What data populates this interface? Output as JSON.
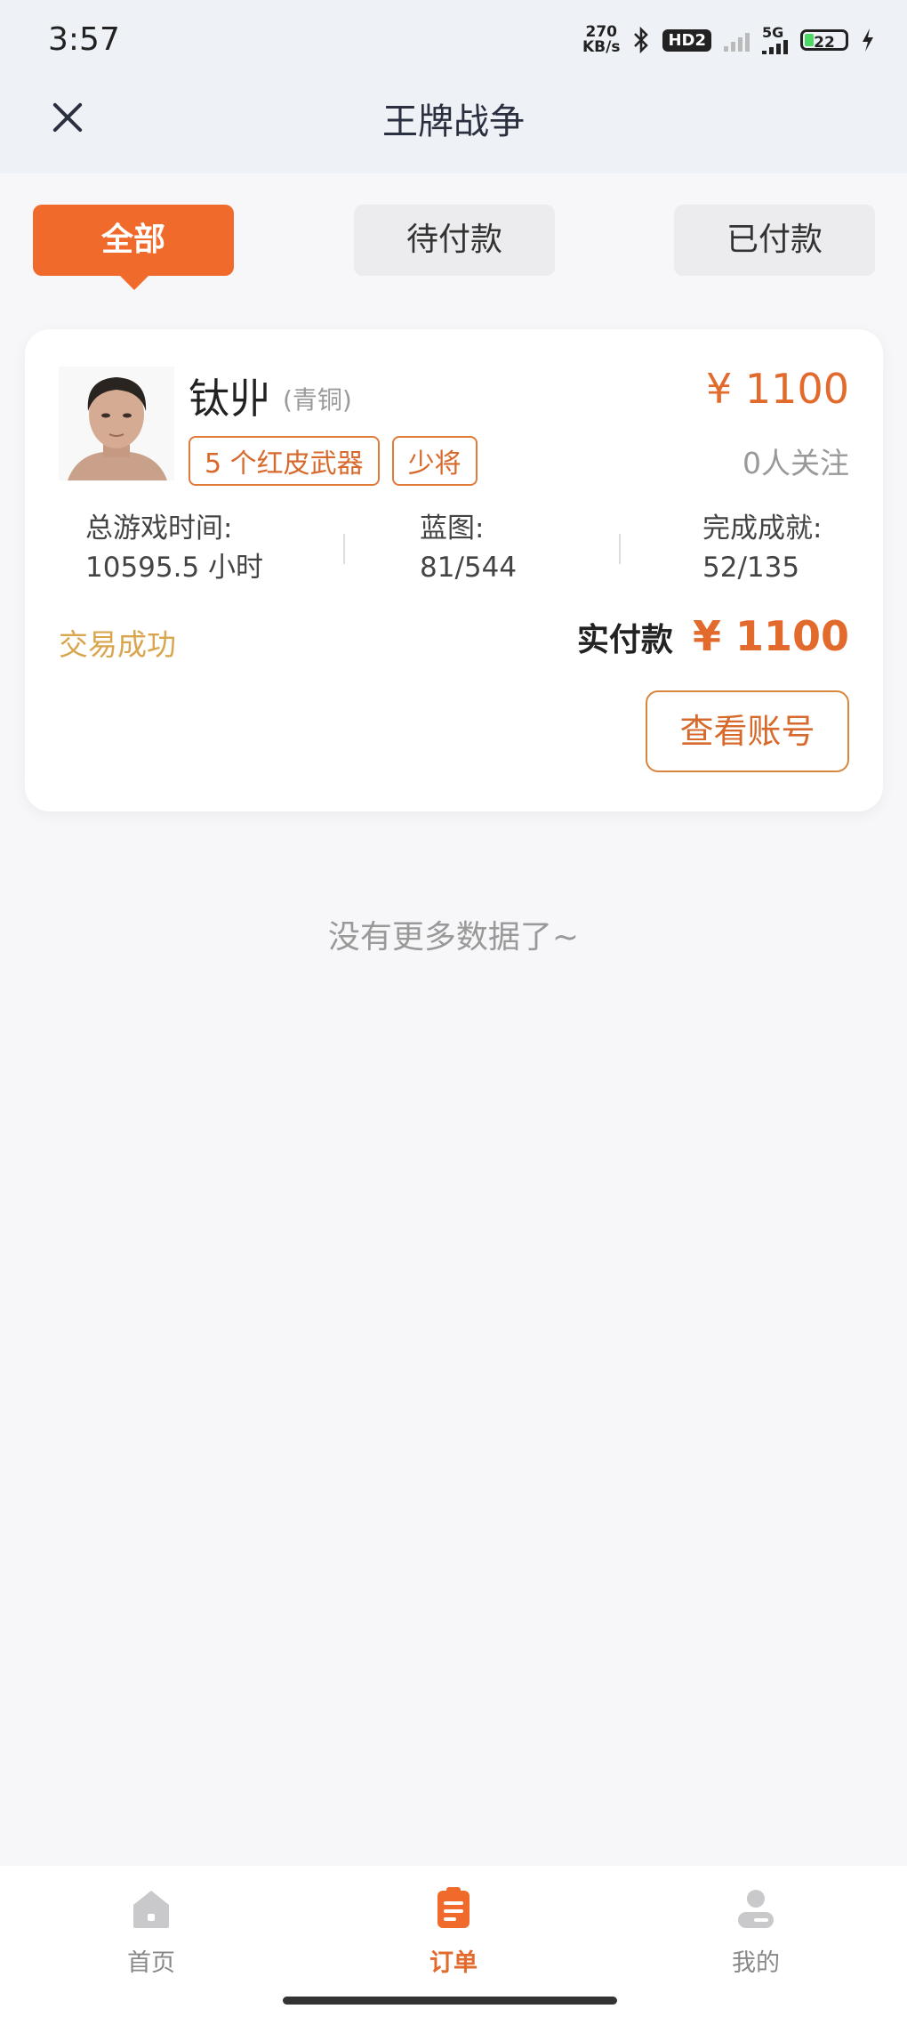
{
  "status_bar": {
    "time": "3:57",
    "net_speed_value": "270",
    "net_speed_unit": "KB/s",
    "hd_badge": "HD2",
    "network": "5G",
    "battery": "22"
  },
  "header": {
    "title": "王牌战争",
    "close_icon": "close-icon"
  },
  "tabs": [
    {
      "label": "全部",
      "active": true
    },
    {
      "label": "待付款",
      "active": false
    },
    {
      "label": "已付款",
      "active": false
    }
  ],
  "order": {
    "nickname": "钛丱",
    "rank": "(青铜)",
    "price": "¥ 1100",
    "tags": [
      "5 个红皮武器",
      "少将"
    ],
    "followers": "0人关注",
    "stats": [
      {
        "label": "总游戏时间:",
        "value": "10595.5 小时"
      },
      {
        "label": "蓝图:",
        "value": "81/544"
      },
      {
        "label": "完成成就:",
        "value": "52/135"
      }
    ],
    "status": "交易成功",
    "paid_label": "实付款",
    "paid_amount": "¥ 1100",
    "view_button": "查看账号"
  },
  "footer_text": "没有更多数据了~",
  "bottom_nav": [
    {
      "label": "首页",
      "icon": "home-icon",
      "active": false
    },
    {
      "label": "订单",
      "icon": "order-icon",
      "active": true
    },
    {
      "label": "我的",
      "icon": "profile-icon",
      "active": false
    }
  ],
  "colors": {
    "accent": "#ef6a2b",
    "success": "#d9a64e"
  }
}
